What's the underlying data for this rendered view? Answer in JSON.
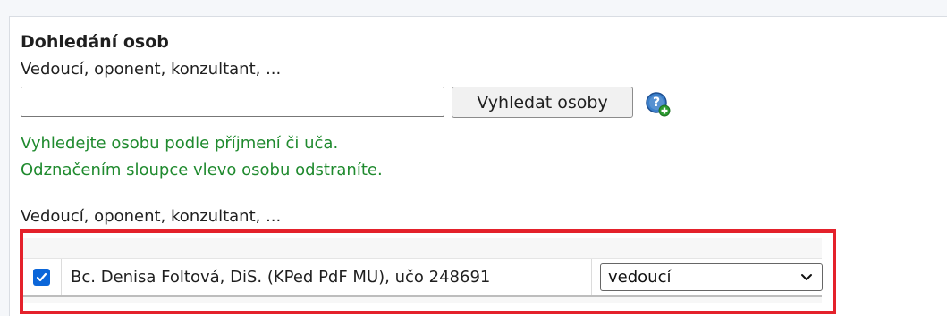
{
  "section": {
    "title": "Dohledání osob",
    "subtitle": "Vedoucí, oponent, konzultant, ..."
  },
  "search": {
    "input_value": "",
    "button_label": "Vyhledat osoby",
    "help_icon": "help-plus-icon"
  },
  "hints": [
    "Vyhledejte osobu podle příjmení či uča.",
    "Odznačením sloupce vlevo osobu odstraníte."
  ],
  "people": {
    "label": "Vedoucí, oponent, konzultant, ...",
    "rows": [
      {
        "checked": true,
        "name": "Bc. Denisa Foltová, DiS. (KPed PdF MU), učo 248691",
        "role": "vedoucí"
      }
    ]
  },
  "colors": {
    "hint_green": "#1f8a2e",
    "highlight_red": "#e4212b",
    "checkbox_blue": "#0b66d9"
  }
}
